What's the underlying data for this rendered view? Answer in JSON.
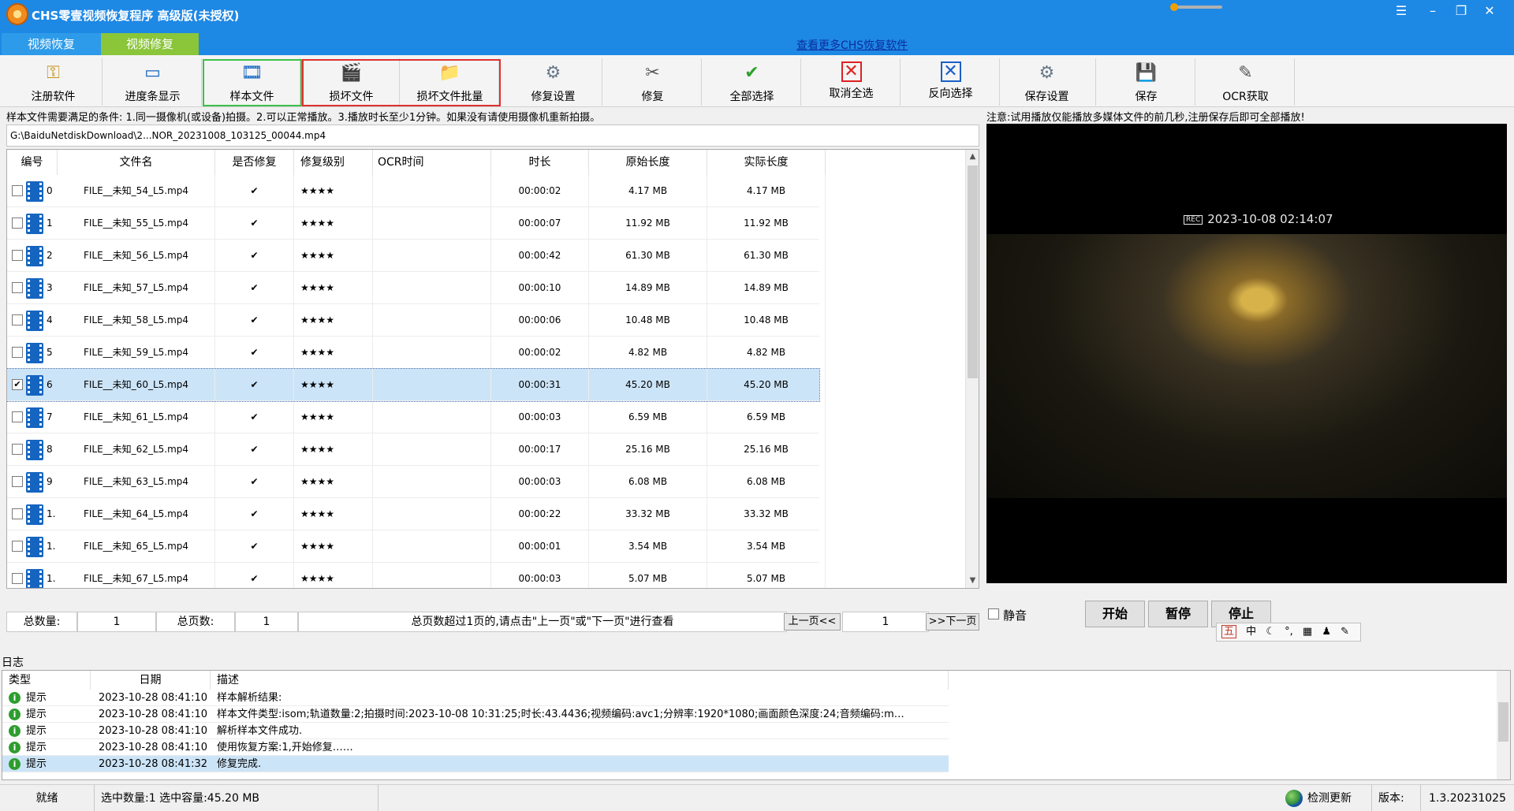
{
  "app": {
    "title": "CHS零壹视频恢复程序 高级版(未授权)"
  },
  "tabs": [
    {
      "label": "视频恢复"
    },
    {
      "label": "视频修复"
    }
  ],
  "header": {
    "more_link": "查看更多CHS恢复软件"
  },
  "toolbar": [
    {
      "label": "注册软件",
      "icon": "key-icon"
    },
    {
      "label": "进度条显示",
      "icon": "progress-icon"
    },
    {
      "label": "样本文件",
      "icon": "film-icon"
    },
    {
      "label": "损坏文件",
      "icon": "broken-file-icon"
    },
    {
      "label": "损坏文件批量",
      "icon": "folder-batch-icon"
    },
    {
      "label": "修复设置",
      "icon": "settings-icon"
    },
    {
      "label": "修复",
      "icon": "tools-icon"
    },
    {
      "label": "全部选择",
      "icon": "check-icon"
    },
    {
      "label": "取消全选",
      "icon": "x-red-icon"
    },
    {
      "label": "反向选择",
      "icon": "x-blue-icon"
    },
    {
      "label": "保存设置",
      "icon": "save-settings-icon"
    },
    {
      "label": "保存",
      "icon": "save-icon"
    },
    {
      "label": "OCR获取",
      "icon": "ocr-icon"
    }
  ],
  "condition_text": "样本文件需要满足的条件: 1.同一摄像机(或设备)拍摄。2.可以正常播放。3.播放时长至少1分钟。如果没有请使用摄像机重新拍摄。",
  "sample_path": "G:\\BaiduNetdiskDownload\\2...NOR_20231008_103125_00044.mp4",
  "table": {
    "columns": [
      "编号",
      "文件名",
      "是否修复",
      "修复级别",
      "OCR时间",
      "时长",
      "原始长度",
      "实际长度"
    ],
    "rows": [
      {
        "idx": "0",
        "name": "FILE__未知_54_L5.mp4",
        "repaired": "✔",
        "level": "★★★★",
        "ocr": "",
        "duration": "00:00:02",
        "orig": "4.17 MB",
        "actual": "4.17 MB",
        "checked": false
      },
      {
        "idx": "1",
        "name": "FILE__未知_55_L5.mp4",
        "repaired": "✔",
        "level": "★★★★",
        "ocr": "",
        "duration": "00:00:07",
        "orig": "11.92 MB",
        "actual": "11.92 MB",
        "checked": false
      },
      {
        "idx": "2",
        "name": "FILE__未知_56_L5.mp4",
        "repaired": "✔",
        "level": "★★★★",
        "ocr": "",
        "duration": "00:00:42",
        "orig": "61.30 MB",
        "actual": "61.30 MB",
        "checked": false
      },
      {
        "idx": "3",
        "name": "FILE__未知_57_L5.mp4",
        "repaired": "✔",
        "level": "★★★★",
        "ocr": "",
        "duration": "00:00:10",
        "orig": "14.89 MB",
        "actual": "14.89 MB",
        "checked": false
      },
      {
        "idx": "4",
        "name": "FILE__未知_58_L5.mp4",
        "repaired": "✔",
        "level": "★★★★",
        "ocr": "",
        "duration": "00:00:06",
        "orig": "10.48 MB",
        "actual": "10.48 MB",
        "checked": false
      },
      {
        "idx": "5",
        "name": "FILE__未知_59_L5.mp4",
        "repaired": "✔",
        "level": "★★★★",
        "ocr": "",
        "duration": "00:00:02",
        "orig": "4.82 MB",
        "actual": "4.82 MB",
        "checked": false
      },
      {
        "idx": "6",
        "name": "FILE__未知_60_L5.mp4",
        "repaired": "✔",
        "level": "★★★★",
        "ocr": "",
        "duration": "00:00:31",
        "orig": "45.20 MB",
        "actual": "45.20 MB",
        "checked": true
      },
      {
        "idx": "7",
        "name": "FILE__未知_61_L5.mp4",
        "repaired": "✔",
        "level": "★★★★",
        "ocr": "",
        "duration": "00:00:03",
        "orig": "6.59 MB",
        "actual": "6.59 MB",
        "checked": false
      },
      {
        "idx": "8",
        "name": "FILE__未知_62_L5.mp4",
        "repaired": "✔",
        "level": "★★★★",
        "ocr": "",
        "duration": "00:00:17",
        "orig": "25.16 MB",
        "actual": "25.16 MB",
        "checked": false
      },
      {
        "idx": "9",
        "name": "FILE__未知_63_L5.mp4",
        "repaired": "✔",
        "level": "★★★★",
        "ocr": "",
        "duration": "00:00:03",
        "orig": "6.08 MB",
        "actual": "6.08 MB",
        "checked": false
      },
      {
        "idx": "1.",
        "name": "FILE__未知_64_L5.mp4",
        "repaired": "✔",
        "level": "★★★★",
        "ocr": "",
        "duration": "00:00:22",
        "orig": "33.32 MB",
        "actual": "33.32 MB",
        "checked": false
      },
      {
        "idx": "1.",
        "name": "FILE__未知_65_L5.mp4",
        "repaired": "✔",
        "level": "★★★★",
        "ocr": "",
        "duration": "00:00:01",
        "orig": "3.54 MB",
        "actual": "3.54 MB",
        "checked": false
      },
      {
        "idx": "1.",
        "name": "FILE__未知_67_L5.mp4",
        "repaired": "✔",
        "level": "★★★★",
        "ocr": "",
        "duration": "00:00:03",
        "orig": "5.07 MB",
        "actual": "5.07 MB",
        "checked": false
      }
    ]
  },
  "paging": {
    "total_label": "总数量:",
    "total_value": "1",
    "pages_label": "总页数:",
    "pages_value": "1",
    "hint": "总页数超过1页的,请点击\"上一页\"或\"下一页\"进行查看",
    "prev_label": "上一页<<",
    "page_value": "1",
    "next_label": ">>下一页"
  },
  "preview": {
    "notice": "注意:试用播放仅能播放多媒体文件的前几秒,注册保存后即可全部播放!",
    "rec_badge": "REC",
    "timestamp": "2023-10-08 02:14:07",
    "mute_label": "静音",
    "start_label": "开始",
    "pause_label": "暂停",
    "stop_label": "停止"
  },
  "ime_bar": [
    "五",
    "中",
    "☾",
    "°,",
    "▦",
    "♟",
    "✎"
  ],
  "log": {
    "title": "日志",
    "columns": [
      "类型",
      "日期",
      "描述"
    ],
    "rows": [
      {
        "type": "提示",
        "date": "2023-10-28 08:41:10",
        "desc": "样本解析结果:"
      },
      {
        "type": "提示",
        "date": "2023-10-28 08:41:10",
        "desc": "样本文件类型:isom;轨道数量:2;拍摄时间:2023-10-08 10:31:25;时长:43.4436;视频编码:avc1;分辨率:1920*1080;画面颜色深度:24;音频编码:m…"
      },
      {
        "type": "提示",
        "date": "2023-10-28 08:41:10",
        "desc": "解析样本文件成功."
      },
      {
        "type": "提示",
        "date": "2023-10-28 08:41:10",
        "desc": "使用恢复方案:1,开始修复……"
      },
      {
        "type": "提示",
        "date": "2023-10-28 08:41:32",
        "desc": "修复完成."
      }
    ]
  },
  "statusbar": {
    "ready": "就绪",
    "selection": "选中数量:1 选中容量:45.20 MB",
    "check_update": "检测更新",
    "version_label": "版本:",
    "version_value": "1.3.20231025"
  }
}
